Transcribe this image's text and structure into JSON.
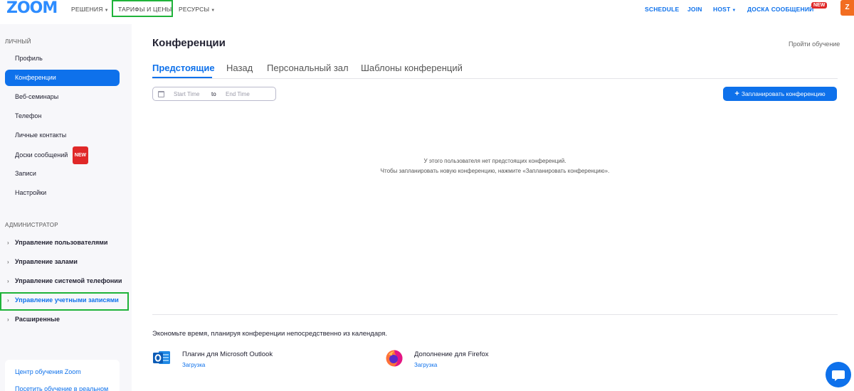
{
  "nav": {
    "logo": "ZOOM",
    "solutions": "РЕШЕНИЯ",
    "pricing": "ТАРИФЫ И ЦЕНЫ",
    "resources": "РЕСУРСЫ",
    "schedule": "SCHEDULE",
    "join": "JOIN",
    "host": "HOST",
    "whiteboards": "ДОСКА СООБЩЕНИЙ",
    "new_badge": "NEW",
    "avatar_letter": "Z"
  },
  "sidebar": {
    "personal_heading": "ЛИЧНЫЙ",
    "items": [
      {
        "label": "Профиль"
      },
      {
        "label": "Конференции"
      },
      {
        "label": "Веб-семинары"
      },
      {
        "label": "Телефон"
      },
      {
        "label": "Личные контакты"
      },
      {
        "label": "Доски сообщений"
      },
      {
        "label": "Записи"
      },
      {
        "label": "Настройки"
      }
    ],
    "new_badge": "NEW",
    "admin_heading": "АДМИНИСТРАТОР",
    "admin_items": [
      {
        "label": "Управление пользователями"
      },
      {
        "label": "Управление залами"
      },
      {
        "label": "Управление системой телефонии"
      },
      {
        "label": "Управление учетными записями"
      },
      {
        "label": "Расширенные"
      }
    ],
    "footer_links": [
      "Центр обучения Zoom",
      "Посетить обучение в реальном"
    ]
  },
  "main": {
    "title": "Конференции",
    "learn_link": "Пройти обучение",
    "tabs": [
      {
        "label": "Предстоящие"
      },
      {
        "label": "Назад"
      },
      {
        "label": "Персональный зал"
      },
      {
        "label": "Шаблоны конференций"
      }
    ],
    "date_filter": {
      "start_placeholder": "Start Time",
      "to": "to",
      "end_placeholder": "End Time"
    },
    "schedule_button": "Запланировать конференцию",
    "empty_line1": "У этого пользователя нет предстоящих конференций.",
    "empty_line2": "Чтобы запланировать новую конференцию, нажмите «Запланировать конференцию».",
    "promo_text": "Экономьте время, планируя конференции непосредственно из календаря.",
    "plugins": [
      {
        "title": "Плагин для Microsoft Outlook",
        "link": "Загрузка",
        "icon": "outlook-icon"
      },
      {
        "title": "Дополнение для Firefox",
        "link": "Загрузка",
        "icon": "firefox-icon"
      }
    ]
  },
  "colors": {
    "accent": "#0E71EB",
    "highlight": "#1fb33a",
    "badge": "#E02828",
    "sidebar_bg": "#F7F7FA"
  }
}
